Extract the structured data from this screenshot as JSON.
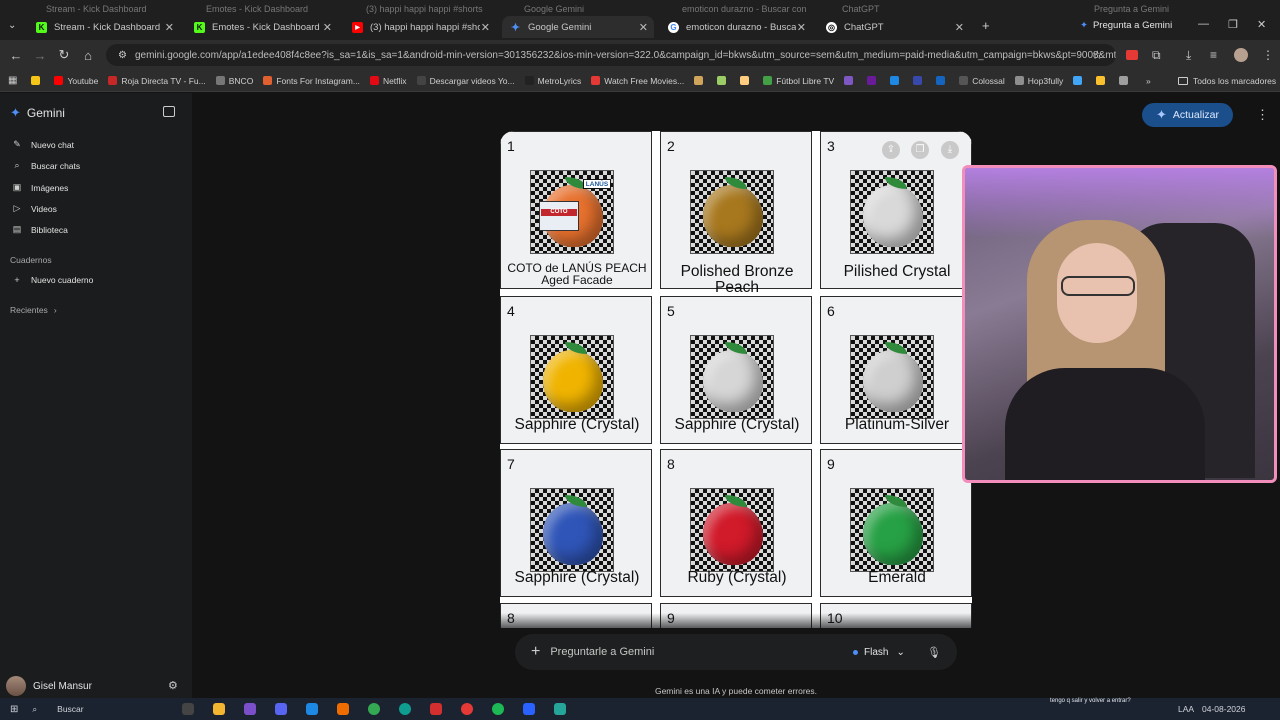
{
  "browser": {
    "ghost_tabs": [
      "Stream - Kick Dashboard",
      "Emotes - Kick Dashboard",
      "(3) happi happi happi #shorts",
      "Google Gemini",
      "emoticon durazno - Buscar con",
      "ChatGPT",
      "Pregunta a Gemini"
    ],
    "tabs": [
      {
        "label": "Stream - Kick Dashboard",
        "icon": "kick-icon",
        "color": "#53fc18",
        "glyph": "K"
      },
      {
        "label": "Emotes - Kick Dashboard",
        "icon": "kick-icon",
        "color": "#53fc18",
        "glyph": "K"
      },
      {
        "label": "(3) happi happi happi #shorts #",
        "icon": "youtube-icon",
        "color": "#ff0000",
        "glyph": "▶"
      },
      {
        "label": "Google Gemini",
        "icon": "gemini-icon",
        "color": "#4e8ef7",
        "glyph": "✦"
      },
      {
        "label": "emoticon durazno - Buscar con",
        "icon": "google-icon",
        "color": "#ffffff",
        "glyph": "G"
      },
      {
        "label": "ChatGPT",
        "icon": "chatgpt-icon",
        "color": "#ffffff",
        "glyph": "◎"
      }
    ],
    "side_panel_label": "Pregunta a Gemini",
    "url": "gemini.google.com/app/a1edee408f4c8ee?is_sa=1&is_sa=1&android-min-version=301356232&ios-min-version=322.0&campaign_id=bkws&utm_source=sem&utm_medium=paid-media&utm_campaign=bkws&pt=9008&mt=8...",
    "bookmarks": [
      {
        "label": "",
        "color": "#f5c518"
      },
      {
        "label": "Youtube",
        "color": "#ff0000"
      },
      {
        "label": "Roja Directa TV - Fu...",
        "color": "#c62828"
      },
      {
        "label": "BNCO",
        "color": "#777777"
      },
      {
        "label": "Fonts For Instagram...",
        "color": "#e06030"
      },
      {
        "label": "Netflix",
        "color": "#e50914"
      },
      {
        "label": "Descargar videos Yo...",
        "color": "#444444"
      },
      {
        "label": "MetroLyrics",
        "color": "#222222"
      },
      {
        "label": "Watch Free Movies...",
        "color": "#e53935"
      },
      {
        "label": "",
        "color": "#cfa55b"
      },
      {
        "label": "",
        "color": "#9ccc65"
      },
      {
        "label": "",
        "color": "#ffcc80"
      },
      {
        "label": "Fútbol Libre TV",
        "color": "#43a047"
      },
      {
        "label": "",
        "color": "#7e57c2"
      },
      {
        "label": "",
        "color": "#6a1b9a"
      },
      {
        "label": "",
        "color": "#1e88e5"
      },
      {
        "label": "",
        "color": "#3949ab"
      },
      {
        "label": "",
        "color": "#1565c0"
      },
      {
        "label": "Colossal",
        "color": "#555555"
      },
      {
        "label": "Hop3fully",
        "color": "#8e8e8e"
      },
      {
        "label": "",
        "color": "#42a5f5"
      },
      {
        "label": "",
        "color": "#fbc02d"
      },
      {
        "label": "",
        "color": "#9e9e9e"
      }
    ],
    "all_bookmarks": "Todos los marcadores"
  },
  "sidebar": {
    "app_name": "Gemini",
    "items": [
      {
        "label": "Nuevo chat",
        "icon": "edit-icon"
      },
      {
        "label": "Buscar chats",
        "icon": "search-icon"
      },
      {
        "label": "Imágenes",
        "icon": "image-icon"
      },
      {
        "label": "Videos",
        "icon": "video-icon"
      },
      {
        "label": "Biblioteca",
        "icon": "library-icon"
      }
    ],
    "notebooks_header": "Cuadernos",
    "new_notebook": "Nuevo cuaderno",
    "recent_header": "Recientes",
    "user_name": "Gisel Mansur"
  },
  "main": {
    "upgrade_label": "Actualizar",
    "prompt_placeholder": "Preguntarle a Gemini",
    "model_label": "Flash",
    "disclaimer": "Gemini es una IA y puede cometer errores."
  },
  "image": {
    "cells": [
      {
        "num": "1",
        "label": "COTO de LANÚS PEACH",
        "label2": "Aged Facade",
        "color": "#e8712e"
      },
      {
        "num": "2",
        "label": "Polished Bronze Peach",
        "label2": "",
        "color": "#a8781e"
      },
      {
        "num": "3",
        "label": "Pilished Crystal",
        "label2": "",
        "color": "#d9d9d9"
      },
      {
        "num": "4",
        "label": "Sapphire (Crystal)",
        "label2": "",
        "color": "#f0b400"
      },
      {
        "num": "5",
        "label": "Sapphire (Crystal)",
        "label2": "",
        "color": "#d6d6d6"
      },
      {
        "num": "6",
        "label": "Platinum-Silver",
        "label2": "",
        "color": "#cfcfcf"
      },
      {
        "num": "7",
        "label": "Sapphire (Crystal)",
        "label2": "",
        "color": "#2f55b8"
      },
      {
        "num": "8",
        "label": "Ruby (Crystal)",
        "label2": "",
        "color": "#d11a2a"
      },
      {
        "num": "9",
        "label": "Emerald",
        "label2": "",
        "color": "#27a145"
      }
    ],
    "partial_nums": [
      "8",
      "9",
      "10"
    ],
    "shop_sign": "COTO",
    "badge": "LANÚS"
  },
  "taskbar": {
    "search": "Buscar",
    "lang": "LAA",
    "date": "04-08-2026",
    "chat_preview": "tengo q salir y volver a entrar?"
  }
}
